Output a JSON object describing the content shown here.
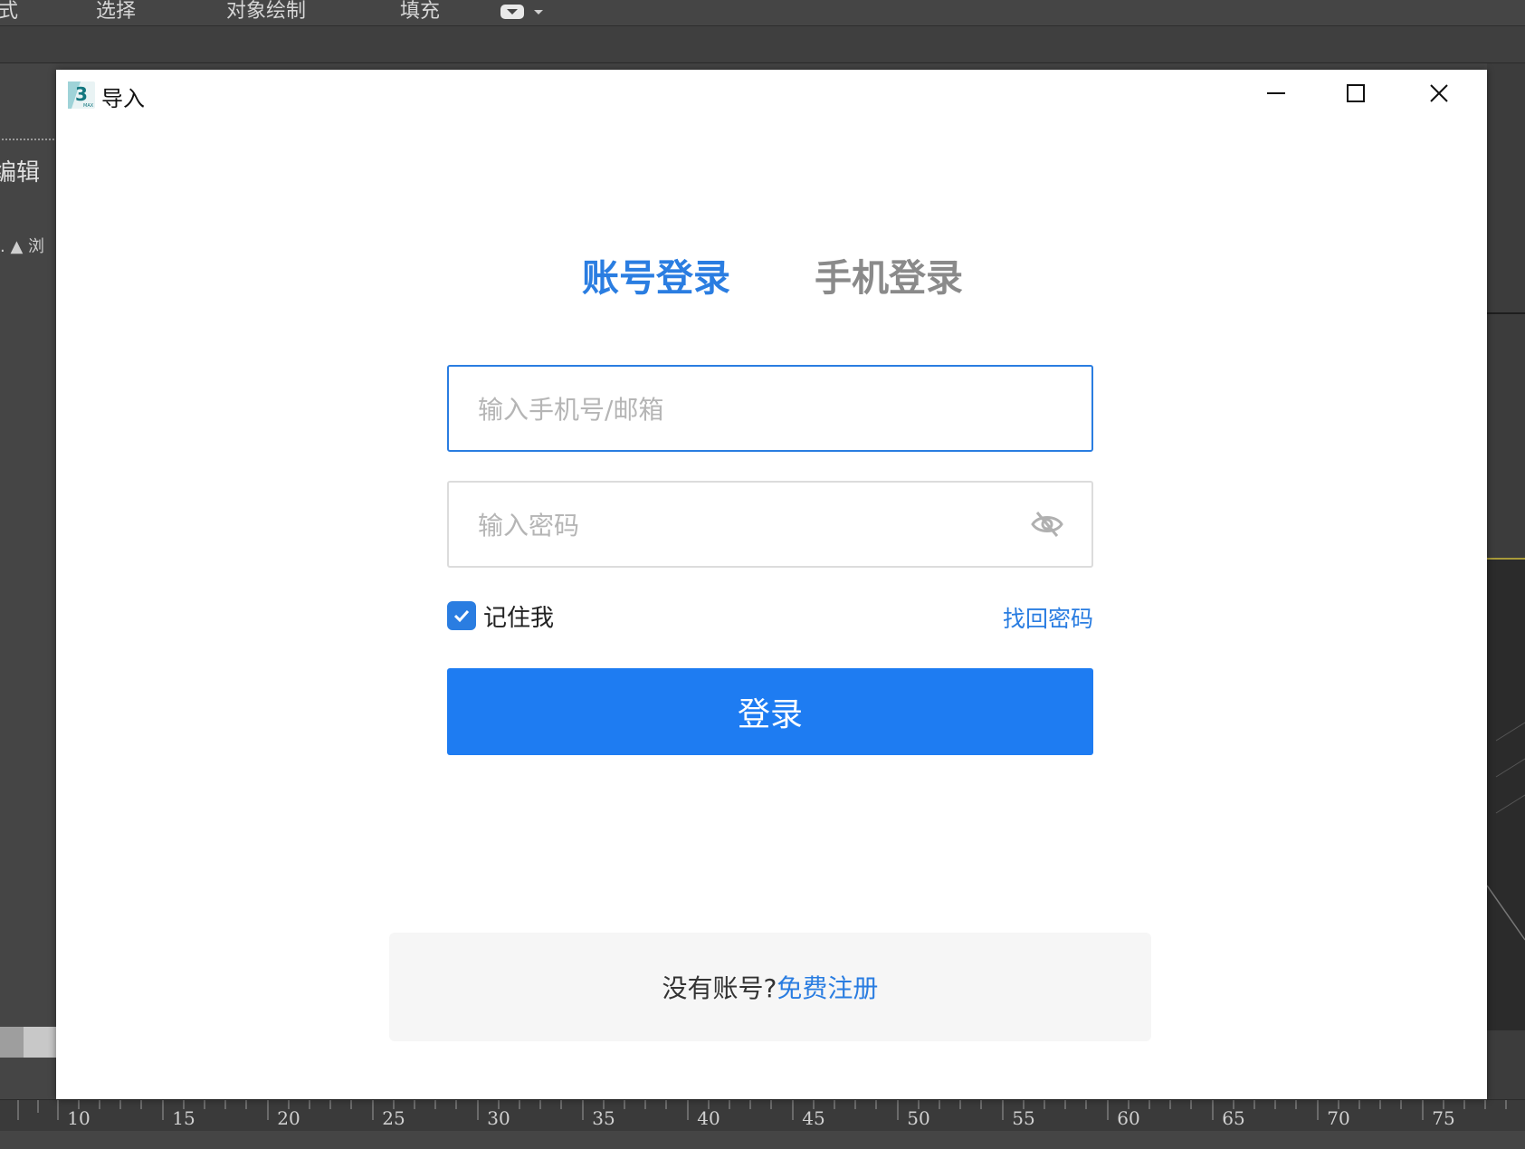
{
  "host_app": {
    "menu": [
      "式",
      "选择",
      "对象绘制",
      "填充"
    ],
    "menu_dropdown_icon": "viewport-dropdown-icon",
    "left_panel": {
      "edit_label": "编辑",
      "row_text": ".  ▲ 浏"
    },
    "timeline_ticks": [
      "10",
      "15",
      "20",
      "25",
      "30",
      "35",
      "40",
      "45",
      "50",
      "55",
      "60",
      "65",
      "70",
      "75"
    ]
  },
  "dialog": {
    "title": "导入",
    "app_icon": "3ds-max-icon",
    "window_controls": [
      "minimize-icon",
      "maximize-icon",
      "close-icon"
    ],
    "tabs": [
      {
        "label": "账号登录",
        "active": true
      },
      {
        "label": "手机登录",
        "active": false
      }
    ],
    "account_input": {
      "placeholder": "输入手机号/邮箱",
      "value": ""
    },
    "password_input": {
      "placeholder": "输入密码",
      "value": "",
      "toggle_icon": "eye-off-icon"
    },
    "remember_me": {
      "label": "记住我",
      "checked": true
    },
    "forgot_password": "找回密码",
    "login_button": "登录",
    "register": {
      "prompt": "没有账号?",
      "link": "免费注册"
    },
    "colors": {
      "accent": "#2a7de1",
      "button": "#1e7cf2",
      "inactive_tab": "#8a8a8a"
    }
  }
}
